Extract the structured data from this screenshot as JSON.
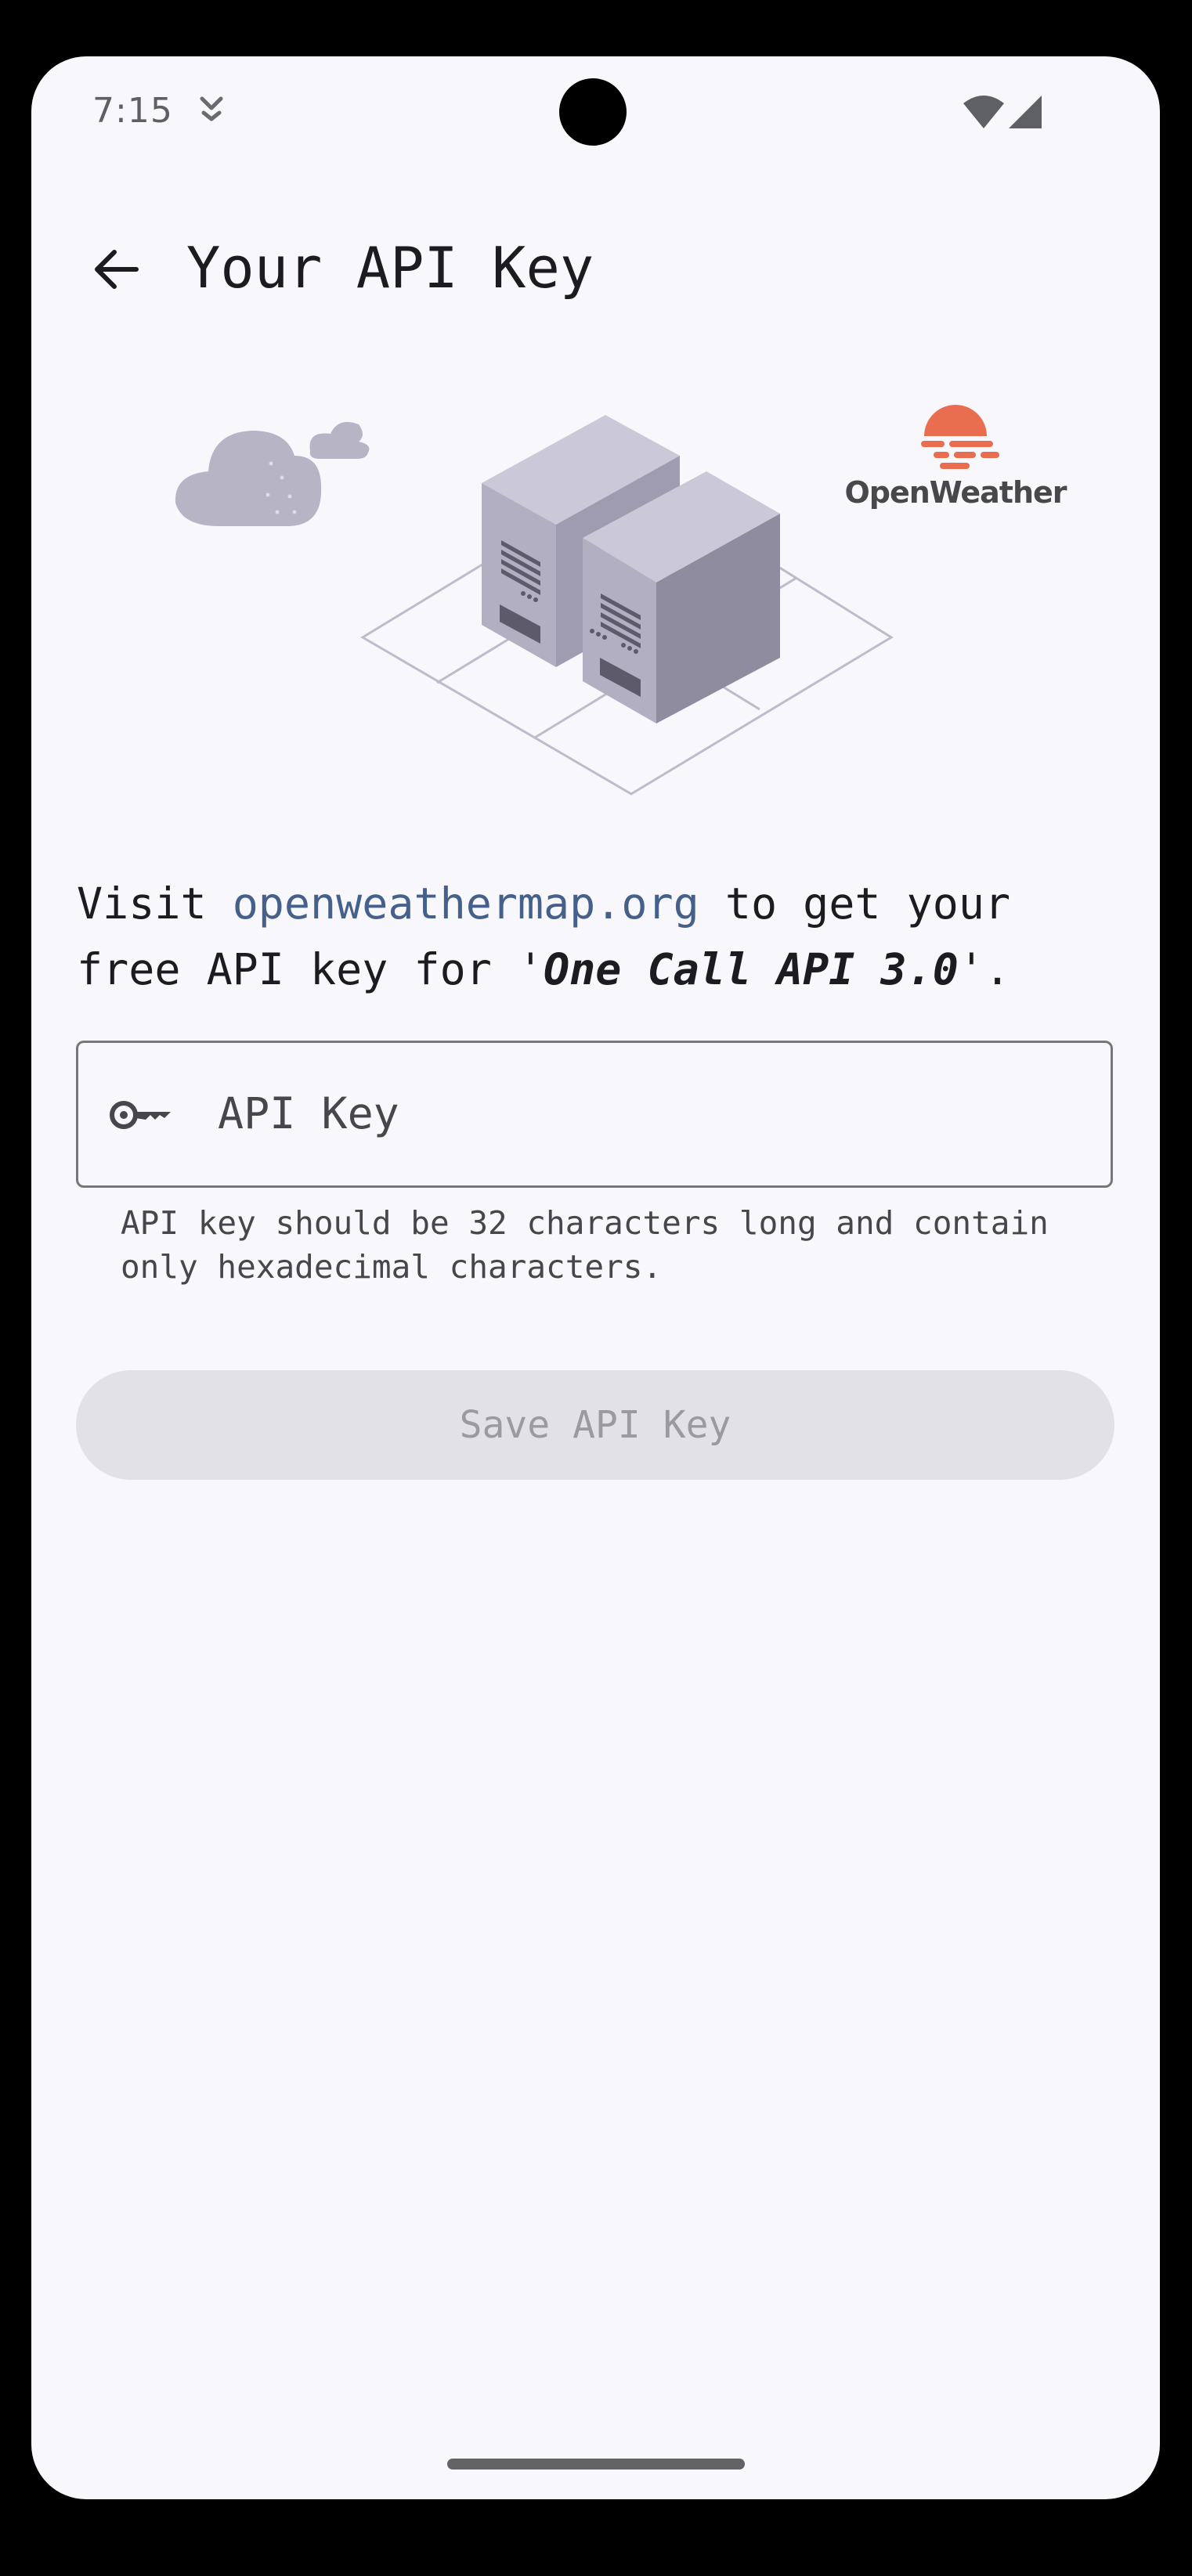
{
  "status_bar": {
    "time": "7:15",
    "icons": [
      "notification-icon",
      "wifi-icon",
      "signal-icon"
    ]
  },
  "app_bar": {
    "title": "Your API Key",
    "back_icon": "arrow-back-icon"
  },
  "brand": {
    "name": "OpenWeather",
    "accent_color": "#e96e50"
  },
  "intro": {
    "prefix": "Visit ",
    "link_text": "openweathermap.org",
    "middle": " to get your free API key for '",
    "emphasis": "One Call API 3.0",
    "suffix": "'."
  },
  "api_field": {
    "placeholder": "API Key",
    "value": "",
    "icon": "key-icon",
    "helper": "API key should be 32 characters long and contain only hexadecimal characters."
  },
  "save_button": {
    "label": "Save API Key",
    "enabled": false
  },
  "colors": {
    "background": "#f8f7fc",
    "link": "#46608c",
    "button_disabled_bg": "#e2e1e6",
    "button_disabled_text": "#9b9aa0"
  }
}
